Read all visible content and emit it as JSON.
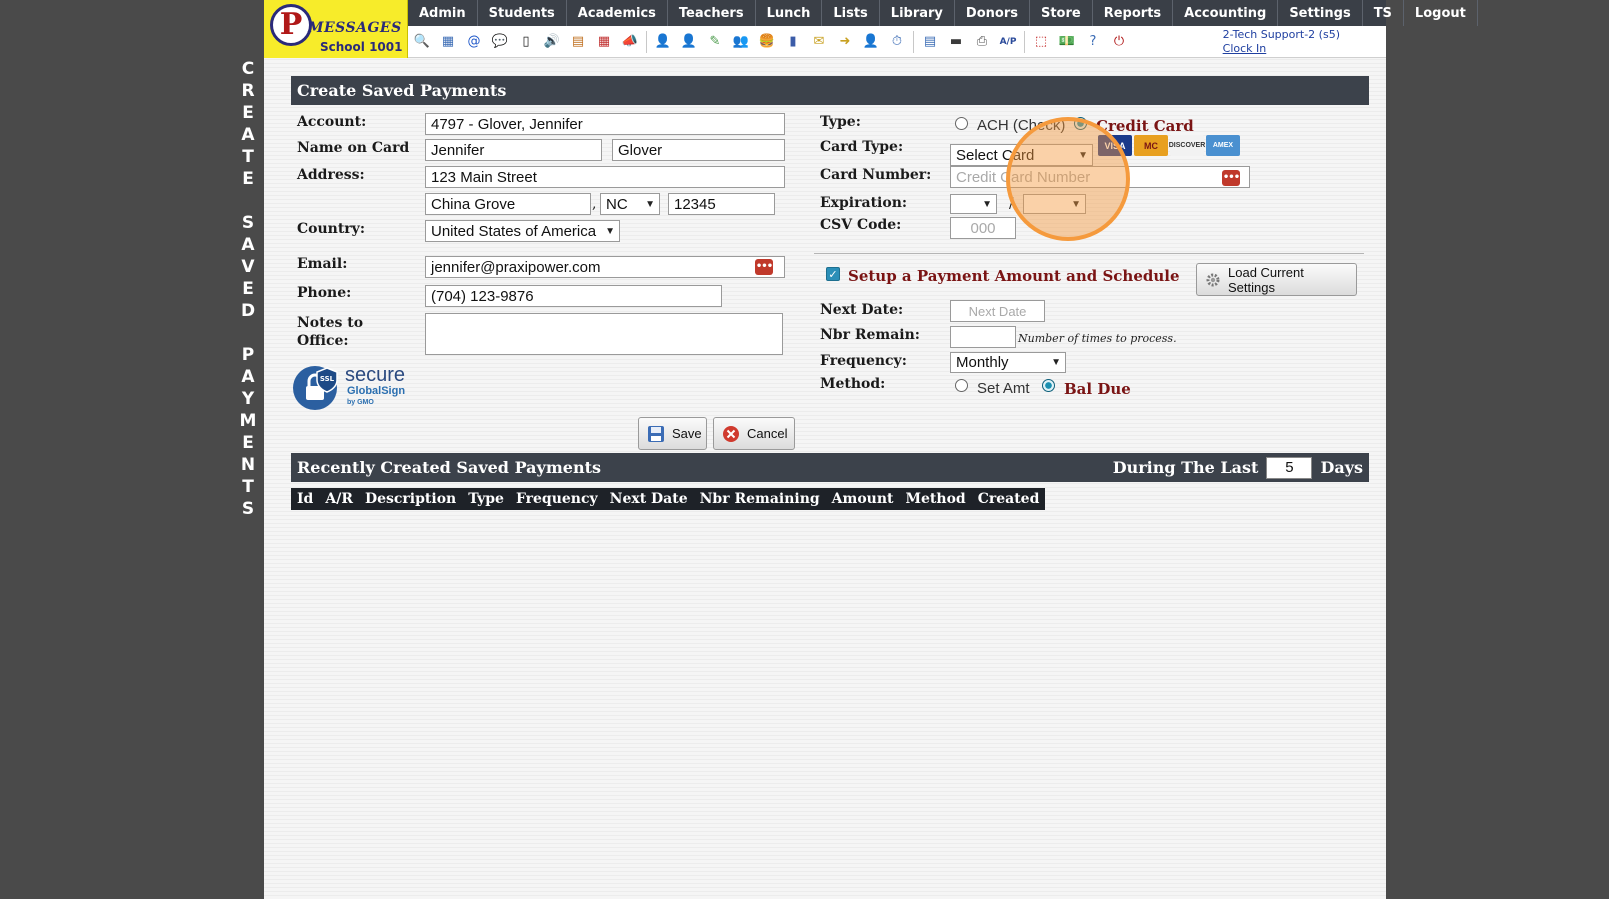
{
  "side_title": [
    "C",
    "R",
    "E",
    "A",
    "T",
    "E",
    "",
    "S",
    "A",
    "V",
    "E",
    "D",
    "",
    "P",
    "A",
    "Y",
    "M",
    "E",
    "N",
    "T",
    "S"
  ],
  "logo": {
    "letter": "P",
    "brand": "MESSAGES",
    "school": "School 1001"
  },
  "nav": [
    "Admin",
    "Students",
    "Academics",
    "Teachers",
    "Lunch",
    "Lists",
    "Library",
    "Donors",
    "Store",
    "Reports",
    "Accounting",
    "Settings",
    "TS",
    "Logout"
  ],
  "toolbar_icons": [
    {
      "name": "search-icon",
      "glyph": "🔍",
      "color": "#5b6fa0"
    },
    {
      "name": "table-icon",
      "glyph": "▦",
      "color": "#3b6cb5"
    },
    {
      "name": "email-at-icon",
      "glyph": "@",
      "color": "#1d56c8"
    },
    {
      "name": "chat-icon",
      "glyph": "💬",
      "color": "#3a9a3a"
    },
    {
      "name": "phone-icon",
      "glyph": "▯",
      "color": "#222"
    },
    {
      "name": "speaker-icon",
      "glyph": "🔊",
      "color": "#555"
    },
    {
      "name": "newsletter-icon",
      "glyph": "▤",
      "color": "#c07020"
    },
    {
      "name": "calendar-icon",
      "glyph": "▦",
      "color": "#c03030"
    },
    {
      "name": "megaphone-icon",
      "glyph": "📣",
      "color": "#555"
    },
    {
      "sep": true
    },
    {
      "name": "student-icon",
      "glyph": "👤",
      "color": "#c05020"
    },
    {
      "name": "teacher-icon",
      "glyph": "👤",
      "color": "#805030"
    },
    {
      "name": "pencil-icon",
      "glyph": "✎",
      "color": "#4a9a4a"
    },
    {
      "name": "group-icon",
      "glyph": "👥",
      "color": "#444"
    },
    {
      "name": "lunch-icon",
      "glyph": "🍔",
      "color": "#c08020"
    },
    {
      "name": "book-icon",
      "glyph": "▮",
      "color": "#3b5ca8"
    },
    {
      "name": "coupon-icon",
      "glyph": "✉",
      "color": "#c8a020"
    },
    {
      "name": "export-icon",
      "glyph": "➜",
      "color": "#c8a020"
    },
    {
      "name": "person-icon",
      "glyph": "👤",
      "color": "#444"
    },
    {
      "name": "clock-icon",
      "glyph": "⏱",
      "color": "#3b6cb5"
    },
    {
      "sep": true
    },
    {
      "name": "grid-icon",
      "glyph": "▤",
      "color": "#3b6cb5"
    },
    {
      "name": "card-icon",
      "glyph": "▬",
      "color": "#3a3a3a"
    },
    {
      "name": "printer-icon",
      "glyph": "⎙",
      "color": "#555"
    },
    {
      "name": "ap-icon",
      "glyph": "A/P",
      "color": "#2a4a9a"
    },
    {
      "sep": true
    },
    {
      "name": "pdf-icon",
      "glyph": "⬚",
      "color": "#c02020"
    },
    {
      "name": "money-icon",
      "glyph": "💵",
      "color": "#3a7a3a"
    },
    {
      "name": "help-icon",
      "glyph": "?",
      "color": "#3b6cb5"
    },
    {
      "name": "power-icon",
      "glyph": "⏻",
      "color": "#b01818"
    }
  ],
  "user": {
    "name": "2-Tech Support-2 (s5)",
    "clock_in": "Clock In"
  },
  "form": {
    "header": "Create Saved Payments",
    "labels": {
      "account": "Account:",
      "name_on_card": "Name on Card",
      "address": "Address:",
      "country": "Country:",
      "email": "Email:",
      "phone": "Phone:",
      "notes_line1": "Notes to",
      "notes_line2": "Office:"
    },
    "account": "4797 - Glover, Jennifer",
    "first_name": "Jennifer",
    "last_name": "Glover",
    "street": "123 Main Street",
    "city": "China Grove",
    "comma": ",",
    "state": "NC",
    "zip": "12345",
    "country": "United States of America",
    "email": "jennifer@praxipower.com",
    "phone": "(704) 123-9876",
    "notes": ""
  },
  "ssl_badge": {
    "ssl": "SSL",
    "secure": "secure",
    "globalsign": "GlobalSign",
    "gmo": "by GMO"
  },
  "payment": {
    "labels": {
      "type": "Type:",
      "card_type": "Card Type:",
      "card_number": "Card Number:",
      "expiration": "Expiration:",
      "csv_code": "CSV Code:"
    },
    "type_options": {
      "ach": "ACH (Check)",
      "credit": "Credit Card",
      "selected": "credit"
    },
    "card_type_value": "Select Card",
    "card_logos": [
      "VISA",
      "MC",
      "DISCOVER",
      "AMEX"
    ],
    "card_number_placeholder": "Credit Card Number",
    "expiration_month": "",
    "expiration_slash": "/",
    "expiration_year": "",
    "csv_placeholder": "000"
  },
  "schedule": {
    "title": "Setup a Payment Amount and Schedule",
    "checked": true,
    "load_button": "Load Current Settings",
    "labels": {
      "next_date": "Next Date:",
      "nbr_remain": "Nbr Remain:",
      "frequency": "Frequency:",
      "method": "Method:"
    },
    "next_date_placeholder": "Next Date",
    "nbr_remain": "",
    "nbr_note": "Number of times to process.",
    "frequency": "Monthly",
    "method_options": {
      "set_amt": "Set Amt",
      "bal_due": "Bal Due",
      "selected": "bal_due"
    }
  },
  "buttons": {
    "save": "Save",
    "cancel": "Cancel"
  },
  "recent": {
    "header": "Recently Created Saved Payments",
    "during_label": "During The Last",
    "days_value": "5",
    "days_label": "Days",
    "columns": [
      "Id",
      "A/R",
      "Description",
      "Type",
      "Frequency",
      "Next Date",
      "Nbr Remaining",
      "Amount",
      "Method",
      "Created"
    ]
  },
  "colors": {
    "accent_red": "#7a1414",
    "header_bg": "#3c424b",
    "highlight": "#f59a3d"
  }
}
